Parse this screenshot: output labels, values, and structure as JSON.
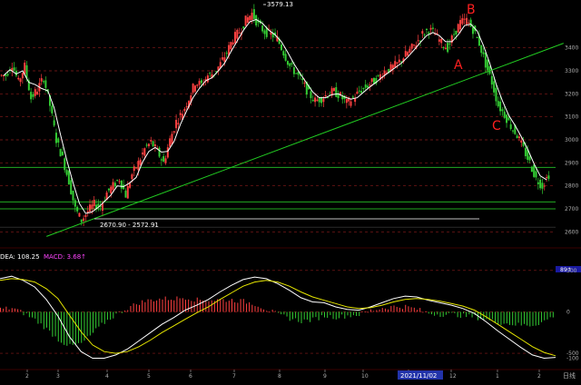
{
  "colors": {
    "background": "#000000",
    "up_candle": "#ff4040",
    "down_candle": "#33cc33",
    "ma_line": "#ffffff",
    "trendline": "#22cc22",
    "grid_dashed": "#8a1a1a",
    "horizontal_level": "#22aa22",
    "dif_line": "#ffffff",
    "dea_line": "#e6e600",
    "indicator_label": "#ffffff",
    "macd_label": "#ff44ff",
    "wave_label": "#ff2020",
    "axis_text": "#b0b0b0",
    "selected_date_bg": "#2233aa"
  },
  "price_panel": {
    "high_annotation": "3579.13",
    "low_annotation": "2670.90 - 2572.91",
    "y_axis_labels": [
      "3400",
      "3300",
      "3200",
      "3100",
      "3000",
      "2900",
      "2800",
      "2700",
      "2600"
    ],
    "wave_labels": [
      "A",
      "B",
      "C"
    ]
  },
  "indicator_panel": {
    "dea_label": "DEA: 108.25",
    "macd_label": "MACD: 3.68↑",
    "y_axis_labels": [
      "89↑",
      "500",
      "0",
      "-500",
      "-100"
    ]
  },
  "time_axis": {
    "months": [
      "2",
      "3",
      "4",
      "5",
      "6",
      "7",
      "8",
      "9",
      "10",
      "11",
      "12",
      "1",
      "2",
      "3"
    ],
    "selected_date": "2021/11/02",
    "period_label": "日线"
  },
  "chart_data": {
    "type": "candlestick",
    "title": "",
    "xlabel": "",
    "ylabel": "",
    "ylim": [
      2550,
      3600
    ],
    "annotations": [
      {
        "label": "3579.13",
        "value": 3579.13
      },
      {
        "label": "2670.90 - 2572.91",
        "value": 2670.9
      },
      {
        "label": "A",
        "value": 3380
      },
      {
        "label": "B",
        "value": 3560
      },
      {
        "label": "C",
        "value": 3130
      }
    ],
    "horizontal_levels": [
      2880,
      2730,
      2700,
      2620
    ],
    "trendline": {
      "from": [
        0.08,
        2580
      ],
      "to": [
        0.97,
        3420
      ]
    },
    "close_path": [
      3280,
      3330,
      3250,
      3320,
      3180,
      3220,
      3270,
      3150,
      3000,
      2920,
      2820,
      2700,
      2650,
      2690,
      2720,
      2710,
      2770,
      2800,
      2830,
      2760,
      2850,
      2900,
      2960,
      2990,
      2950,
      2900,
      3000,
      3080,
      3120,
      3180,
      3250,
      3240,
      3280,
      3290,
      3330,
      3380,
      3440,
      3470,
      3520,
      3550,
      3500,
      3470,
      3460,
      3440,
      3380,
      3320,
      3290,
      3250,
      3200,
      3170,
      3180,
      3200,
      3210,
      3190,
      3160,
      3180,
      3210,
      3230,
      3250,
      3270,
      3300,
      3310,
      3330,
      3360,
      3390,
      3420,
      3460,
      3480,
      3460,
      3420,
      3400,
      3460,
      3510,
      3520,
      3480,
      3420,
      3330,
      3250,
      3150,
      3110,
      3060,
      3020,
      2960,
      2900,
      2830,
      2800,
      2850
    ],
    "macd": {
      "dea": 108.25,
      "macd": 3.68,
      "dif_path": [
        400,
        430,
        380,
        300,
        150,
        -50,
        -300,
        -480,
        -560,
        -560,
        -520,
        -450,
        -350,
        -250,
        -150,
        -70,
        20,
        80,
        150,
        240,
        320,
        390,
        420,
        400,
        340,
        260,
        170,
        120,
        110,
        60,
        30,
        20,
        60,
        110,
        160,
        190,
        180,
        140,
        110,
        80,
        40,
        -20,
        -120,
        -230,
        -330,
        -430,
        -520,
        -560,
        -550
      ],
      "dea_path": [
        380,
        400,
        390,
        360,
        280,
        160,
        -40,
        -240,
        -400,
        -480,
        -500,
        -480,
        -420,
        -340,
        -250,
        -170,
        -90,
        -10,
        60,
        150,
        230,
        310,
        360,
        380,
        360,
        310,
        240,
        180,
        140,
        100,
        60,
        40,
        50,
        80,
        120,
        150,
        160,
        150,
        130,
        100,
        70,
        20,
        -60,
        -150,
        -240,
        -330,
        -420,
        -490,
        -530
      ]
    }
  }
}
